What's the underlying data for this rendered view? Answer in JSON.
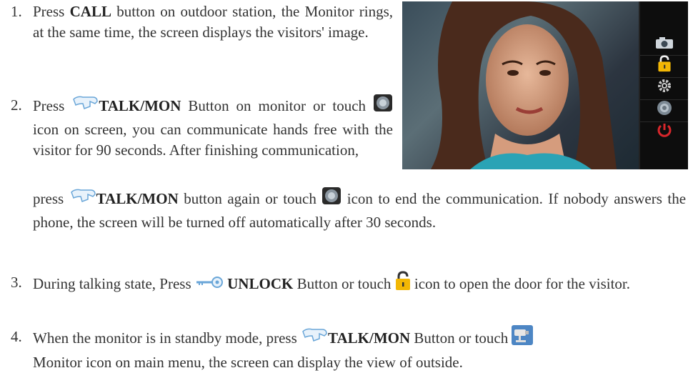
{
  "items": [
    {
      "number": "1.",
      "parts": [
        "Press ",
        "CALL",
        " button on outdoor station, the Monitor rings, at the same time, the screen displays the visitors' image."
      ]
    },
    {
      "number": "2.",
      "parts": [
        " ",
        "TALK/MON",
        " Button on monitor or touch ",
        " icon on screen, you can communicate hands free with the visitor for 90 seconds. After finishing communication,",
        "press ",
        "TALK/MON",
        " button again or touch ",
        " icon to end the communication. If nobody answers the phone, the screen will be turned off automatically after 30 seconds."
      ],
      "press_word": "Press"
    },
    {
      "number": "3.",
      "parts": [
        "During talking state, Press ",
        "UNLOCK",
        " Button or touch ",
        " icon to open the door for the visitor."
      ]
    },
    {
      "number": "4.",
      "parts": [
        "When the monitor is in standby mode, press ",
        "TALK/MON",
        " Button or touch ",
        "Monitor icon on main menu, the screen can display the view of outside."
      ]
    }
  ],
  "monitor": {
    "side_icons": [
      "camera-icon",
      "lock-icon",
      "gear-icon",
      "speaker-icon",
      "power-icon"
    ]
  },
  "colors": {
    "text": "#333333",
    "lock_yellow": "#f2b705",
    "power_red": "#d8262b",
    "icon_blue": "#6aa6d8"
  }
}
